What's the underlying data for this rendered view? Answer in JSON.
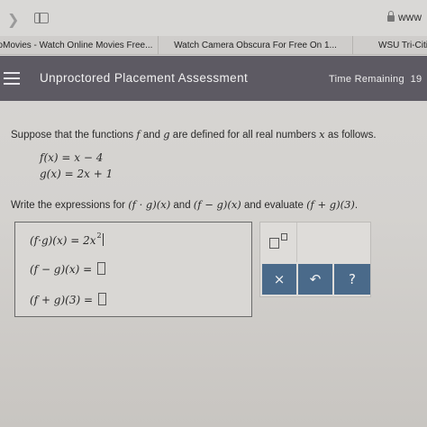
{
  "browser": {
    "url": "www",
    "tabs": [
      {
        "label": "oMovies - Watch Online Movies Free..."
      },
      {
        "label": "Watch Camera Obscura For Free On 1..."
      },
      {
        "label": "WSU Tri-Citi"
      }
    ],
    "icons": [
      "chevron-right-icon",
      "sidebar-icon",
      "lock-icon"
    ]
  },
  "header": {
    "title": "Unproctored Placement Assessment",
    "time_label": "Time Remaining",
    "time_value": "19"
  },
  "problem": {
    "intro_1": "Suppose that the functions ",
    "f": "f",
    "and": " and ",
    "g": "g",
    "intro_2": " are defined for all real numbers ",
    "x": "x",
    "intro_3": " as follows.",
    "def_f": "f(x) = x − 4",
    "def_g": "g(x) = 2x + 1",
    "instruct_1": "Write the expressions for ",
    "expr_1": "(f · g)(x)",
    "instruct_2": " and ",
    "expr_2": "(f − g)(x)",
    "instruct_3": " and evaluate ",
    "expr_3": "(f + g)(3)",
    "instruct_4": "."
  },
  "answers": {
    "row1_label": "(f·g)(x) = ",
    "row1_value": "2x",
    "row1_exponent": "2",
    "row2_label": "(f − g)(x) = ",
    "row3_label": "(f + g)(3) = "
  },
  "palette": {
    "clear_label": "×",
    "undo_label": "↶",
    "help_label": "?"
  },
  "colors": {
    "header_bg": "#5d5a63",
    "button_bg": "#4a6a8a"
  }
}
